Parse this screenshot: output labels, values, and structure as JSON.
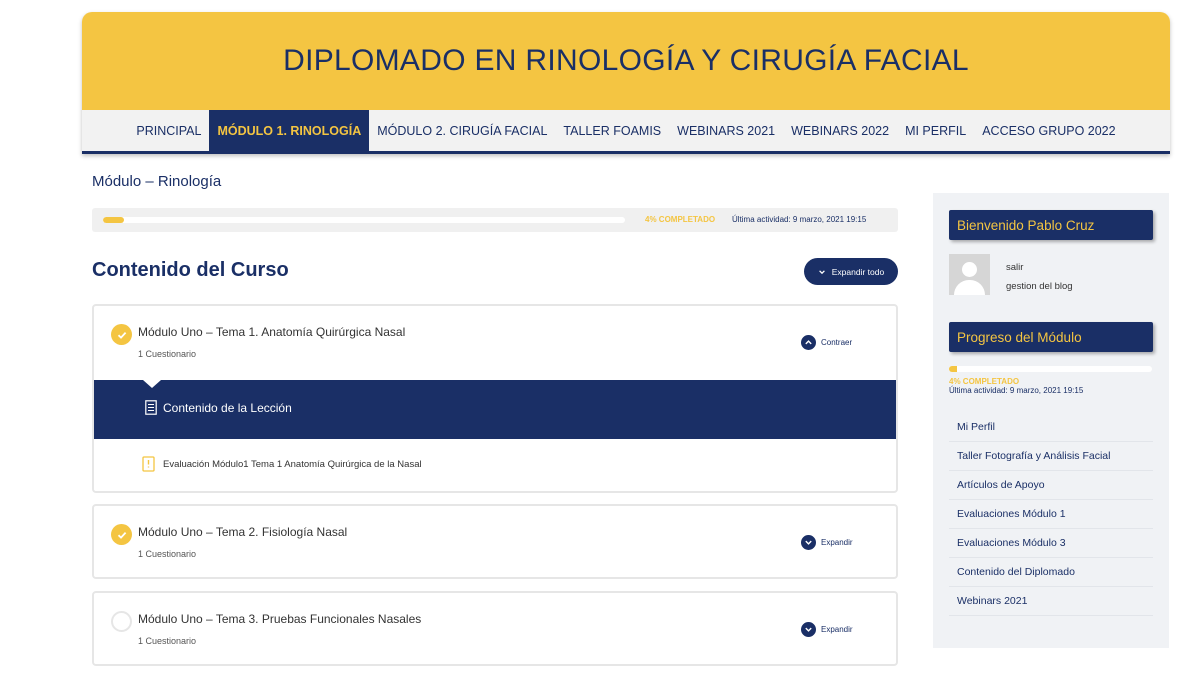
{
  "header": {
    "title": "DIPLOMADO EN RINOLOGÍA Y CIRUGÍA FACIAL",
    "nav": [
      {
        "label": "PRINCIPAL"
      },
      {
        "label": "MÓDULO 1. RINOLOGÍA"
      },
      {
        "label": "MÓDULO 2. CIRUGÍA FACIAL"
      },
      {
        "label": "TALLER FOAMIS"
      },
      {
        "label": "WEBINARS 2021"
      },
      {
        "label": "WEBINARS 2022"
      },
      {
        "label": "MI PERFIL"
      },
      {
        "label": "ACCESO GRUPO 2022"
      }
    ],
    "active_nav": "MÓDULO 1. RINOLOGÍA"
  },
  "main": {
    "page_title": "Módulo – Rinología",
    "progress": {
      "percent": 4,
      "label": "4% COMPLETADO",
      "last_activity": "Última actividad: 9 marzo, 2021 19:15"
    },
    "course_heading": "Contenido del Curso",
    "expand_all_label": "Expandir todo",
    "lessons": [
      {
        "title": "Módulo Uno – Tema 1. Anatomía Quirúrgica Nasal",
        "subtitle": "1 Cuestionario",
        "completed": true,
        "toggle_label": "Contraer",
        "expanded": true,
        "content_label": "Contenido de la Lección",
        "quiz_title": "Evaluación Módulo1 Tema 1 Anatomía Quirúrgica de la Nasal"
      },
      {
        "title": "Módulo Uno – Tema 2. Fisiología Nasal",
        "subtitle": "1 Cuestionario",
        "completed": true,
        "toggle_label": "Expandir"
      },
      {
        "title": "Módulo Uno – Tema 3. Pruebas Funcionales Nasales",
        "subtitle": "1 Cuestionario",
        "completed": false,
        "toggle_label": "Expandir"
      }
    ]
  },
  "sidebar": {
    "welcome_title": "Bienvenido Pablo Cruz",
    "user_links": [
      "salir",
      "gestion del blog"
    ],
    "progress_title": "Progreso del Módulo",
    "progress": {
      "percent": 4,
      "label": "4% COMPLETADO",
      "last_activity": "Última actividad: 9 marzo, 2021 19:15"
    },
    "menu": [
      "Mi Perfil",
      "Taller Fotografía y Análisis Facial",
      "Artículos de Apoyo",
      "Evaluaciones Módulo 1",
      "Evaluaciones Módulo 3",
      "Contenido del Diplomado",
      "Webinars 2021"
    ]
  },
  "colors": {
    "navy": "#1a2f66",
    "gold": "#f4c542",
    "light_gray": "#f0f2f5"
  }
}
